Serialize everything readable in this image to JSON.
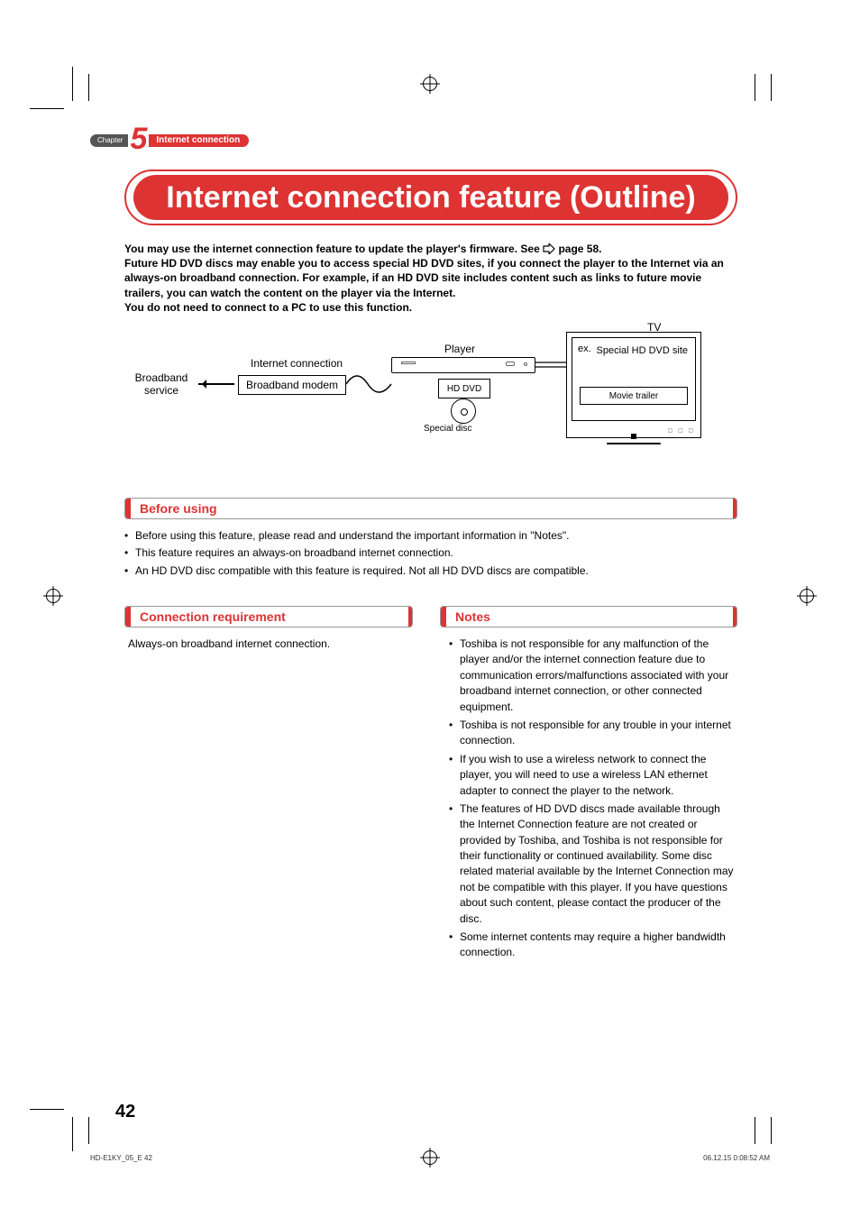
{
  "chapter": {
    "word": "Chapter",
    "number": "5",
    "name": "Internet connection"
  },
  "title": "Internet connection feature (Outline)",
  "intro": {
    "line1a": "You may use the internet connection feature to update the player's firmware. See ",
    "line1b": " page 58.",
    "line2": "Future HD DVD discs may enable you to access special HD DVD sites, if you connect the player to the Internet via an always-on broadband connection. For example, if an HD DVD site includes content such as links to future movie trailers, you can watch the content on the player via the Internet.",
    "line3": "You do not need to connect to a PC to use this function."
  },
  "diagram": {
    "broadband_service": "Broadband service",
    "internet_connection": "Internet connection",
    "broadband_modem": "Broadband modem",
    "player": "Player",
    "hd_dvd": "HD DVD",
    "special_disc": "Special disc",
    "tv": "TV",
    "ex": "ex.",
    "special_site": "Special HD DVD site",
    "movie_trailer": "Movie trailer"
  },
  "sections": {
    "before_using": "Before using",
    "connection_requirement": "Connection requirement",
    "notes": "Notes"
  },
  "before_list": [
    "Before using this feature, please read and understand the important information in \"Notes\".",
    "This feature requires an always-on broadband internet connection.",
    "An HD DVD disc compatible with this feature is required. Not all HD DVD discs are compatible."
  ],
  "connection_text": "Always-on broadband internet connection.",
  "notes_list": [
    "Toshiba is not responsible for any malfunction of the player and/or the internet connection feature due to communication errors/malfunctions associated with your broadband internet connection, or other connected equipment.",
    "Toshiba is not responsible for any trouble in your internet connection.",
    "If you wish to use a wireless network to connect the player, you will need to use a wireless LAN ethernet adapter to connect the player to the network.",
    "The features of HD DVD discs made available through the Internet Connection feature are not created or provided by Toshiba, and Toshiba is not responsible for their functionality or continued availability. Some disc related material available by the Internet Connection may not be compatible with this player. If you have questions about such content, please contact the producer of the disc.",
    "Some internet contents may require a higher bandwidth connection."
  ],
  "page_number": "42",
  "footer": {
    "left": "HD-E1KY_05_E   42",
    "right": "06.12.15   0:08:52 AM"
  }
}
